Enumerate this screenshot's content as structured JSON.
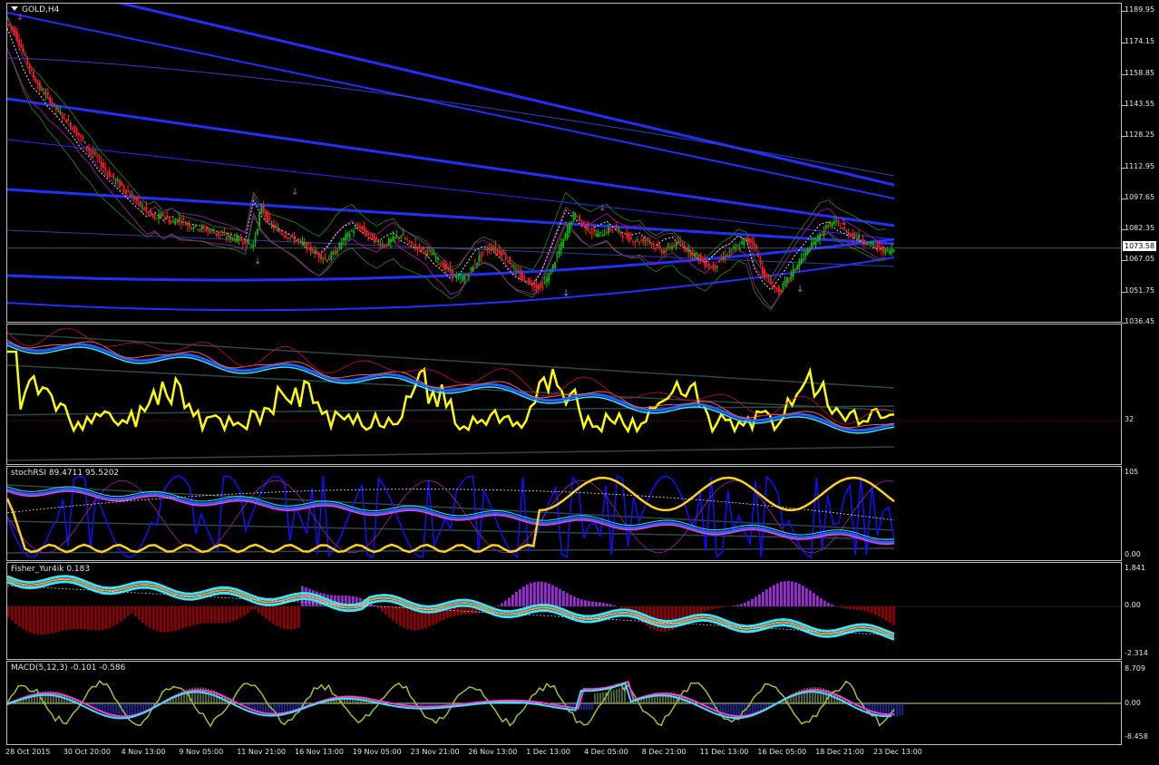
{
  "chart_data": [
    {
      "type": "candlestick",
      "title": "GOLD,H4",
      "ylim": [
        1036.45,
        1194.0
      ],
      "y_ticks": [
        "1189.95",
        "1174.15",
        "1158.85",
        "1143.55",
        "1128.25",
        "1112.95",
        "1097.65",
        "1082.35",
        "1067.05",
        "1051.75",
        "1036.45"
      ],
      "current_price": "1073.58",
      "close_approx": [
        1180,
        1170,
        1160,
        1152,
        1148,
        1142,
        1138,
        1133,
        1128,
        1122,
        1118,
        1112,
        1108,
        1104,
        1100,
        1096,
        1092,
        1088,
        1090,
        1086,
        1088,
        1085,
        1084,
        1083,
        1082,
        1080,
        1079,
        1078,
        1077,
        1075,
        1094,
        1086,
        1082,
        1080,
        1078,
        1076,
        1073,
        1070,
        1068,
        1072,
        1078,
        1082,
        1084,
        1080,
        1077,
        1075,
        1078,
        1080,
        1076,
        1074,
        1072,
        1070,
        1065,
        1062,
        1058,
        1060,
        1066,
        1072,
        1074,
        1072,
        1068,
        1062,
        1058,
        1056,
        1054,
        1060,
        1070,
        1080,
        1090,
        1086,
        1082,
        1080,
        1082,
        1084,
        1080,
        1078,
        1077,
        1078,
        1074,
        1072,
        1075,
        1076,
        1072,
        1070,
        1066,
        1064,
        1068,
        1072,
        1074,
        1078,
        1076,
        1062,
        1056,
        1052,
        1058,
        1064,
        1070,
        1075,
        1080,
        1085,
        1086,
        1082,
        1080,
        1078,
        1076,
        1074,
        1072,
        1073
      ]
    },
    {
      "type": "line",
      "title": "",
      "y_ticks": [
        "32"
      ]
    },
    {
      "type": "line",
      "title": "stochRSI 89.4711 95.5202",
      "y_ticks": [
        "105",
        "0.00"
      ]
    },
    {
      "type": "bar",
      "title": "Fisher_Yur4ik 0.183",
      "y_ticks": [
        "1.841",
        "0.00",
        "-2.314"
      ]
    },
    {
      "type": "bar",
      "title": "MACD(5,12,3) -0.101 -0.586",
      "y_ticks": [
        "8.709",
        "0.00",
        "-8.458"
      ]
    }
  ],
  "time_axis": [
    "28 Oct 2015",
    "30 Oct 20:00",
    "4 Nov 13:00",
    "9 Nov 05:00",
    "11 Nov 21:00",
    "16 Nov 13:00",
    "19 Nov 05:00",
    "23 Nov 21:00",
    "26 Nov 13:00",
    "1 Dec 13:00",
    "4 Dec 05:00",
    "8 Dec 21:00",
    "11 Dec 13:00",
    "16 Dec 05:00",
    "18 Dec 21:00",
    "23 Dec 13:00"
  ],
  "colors": {
    "background": "#000000",
    "bull": "#00c000",
    "bear": "#ff2020",
    "band_blue": "#2020ff",
    "rsi_yellow": "#ffff00",
    "histogram_purple": "#9a2bd0",
    "histogram_red": "#8b0000",
    "cyan": "#40e0ff",
    "magenta": "#ff3fd0",
    "olive": "#a0c040"
  }
}
